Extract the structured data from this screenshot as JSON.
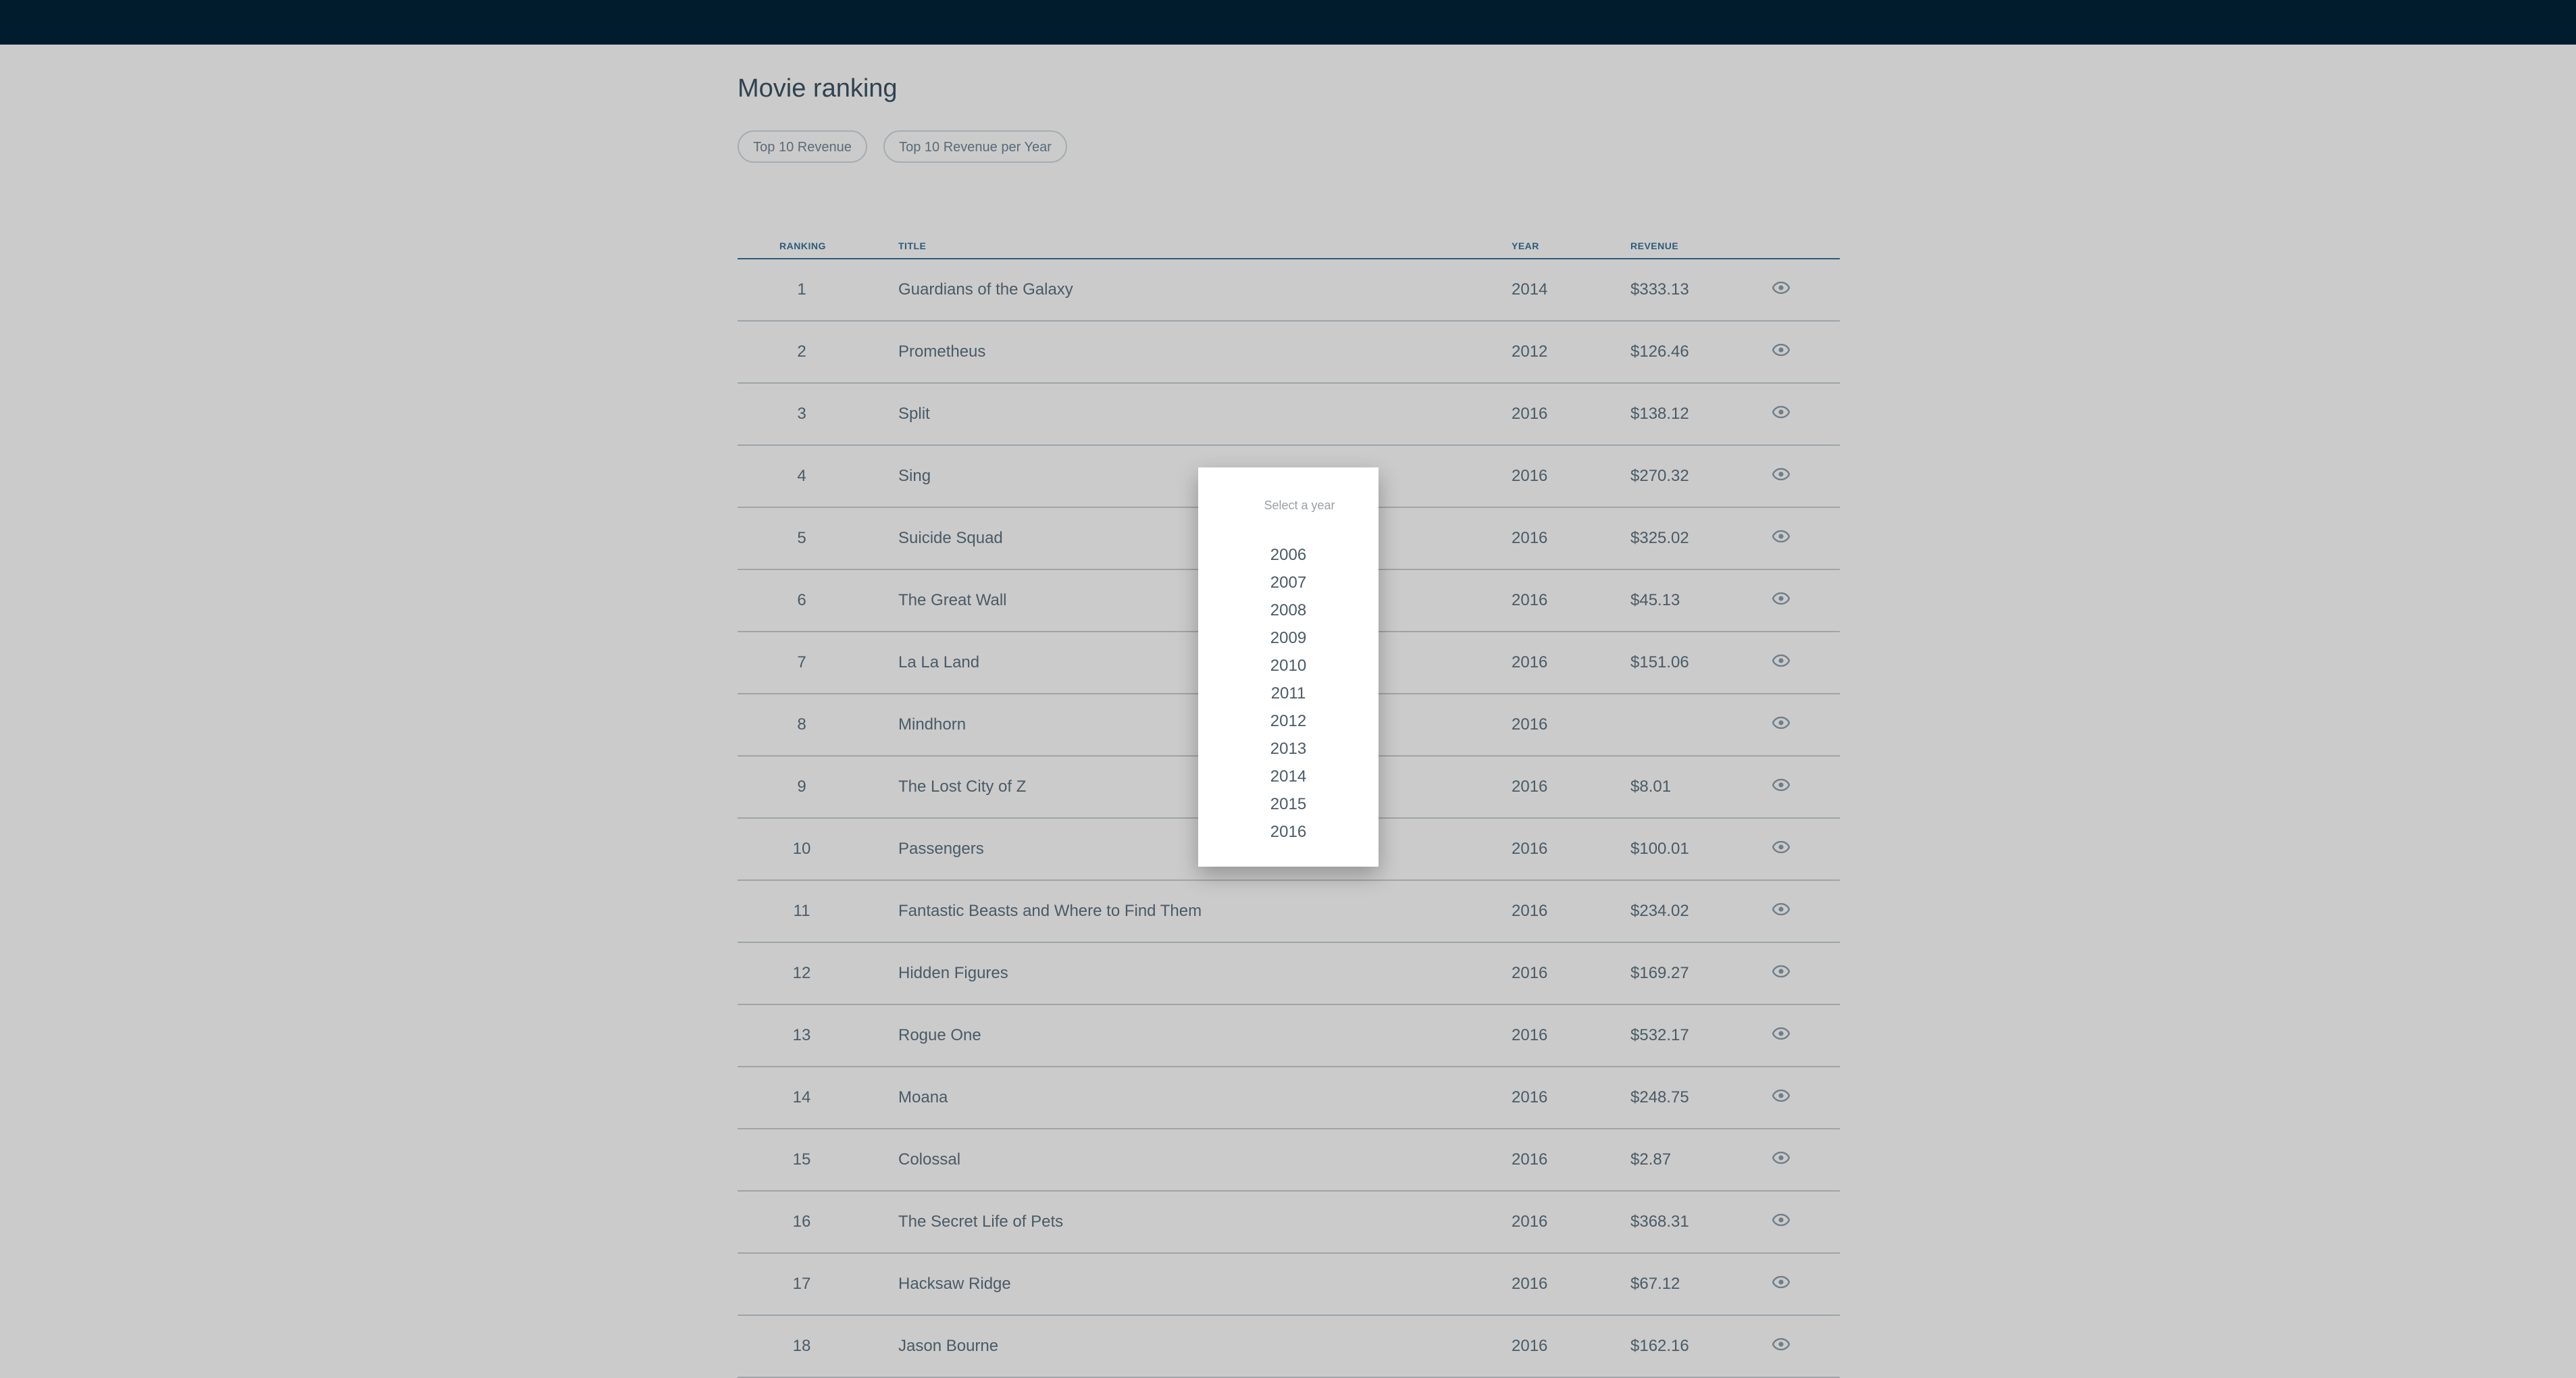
{
  "page": {
    "title": "Movie ranking"
  },
  "filters": {
    "top10": "Top 10 Revenue",
    "top10_per_year": "Top 10 Revenue per Year"
  },
  "table": {
    "headers": {
      "ranking": "RANKING",
      "title": "TITLE",
      "year": "YEAR",
      "revenue": "REVENUE"
    },
    "rows": [
      {
        "rank": "1",
        "title": "Guardians of the Galaxy",
        "year": "2014",
        "revenue": "$333.13"
      },
      {
        "rank": "2",
        "title": "Prometheus",
        "year": "2012",
        "revenue": "$126.46"
      },
      {
        "rank": "3",
        "title": "Split",
        "year": "2016",
        "revenue": "$138.12"
      },
      {
        "rank": "4",
        "title": "Sing",
        "year": "2016",
        "revenue": "$270.32"
      },
      {
        "rank": "5",
        "title": "Suicide Squad",
        "year": "2016",
        "revenue": "$325.02"
      },
      {
        "rank": "6",
        "title": "The Great Wall",
        "year": "2016",
        "revenue": "$45.13"
      },
      {
        "rank": "7",
        "title": "La La Land",
        "year": "2016",
        "revenue": "$151.06"
      },
      {
        "rank": "8",
        "title": "Mindhorn",
        "year": "2016",
        "revenue": ""
      },
      {
        "rank": "9",
        "title": "The Lost City of Z",
        "year": "2016",
        "revenue": "$8.01"
      },
      {
        "rank": "10",
        "title": "Passengers",
        "year": "2016",
        "revenue": "$100.01"
      },
      {
        "rank": "11",
        "title": "Fantastic Beasts and Where to Find Them",
        "year": "2016",
        "revenue": "$234.02"
      },
      {
        "rank": "12",
        "title": "Hidden Figures",
        "year": "2016",
        "revenue": "$169.27"
      },
      {
        "rank": "13",
        "title": "Rogue One",
        "year": "2016",
        "revenue": "$532.17"
      },
      {
        "rank": "14",
        "title": "Moana",
        "year": "2016",
        "revenue": "$248.75"
      },
      {
        "rank": "15",
        "title": "Colossal",
        "year": "2016",
        "revenue": "$2.87"
      },
      {
        "rank": "16",
        "title": "The Secret Life of Pets",
        "year": "2016",
        "revenue": "$368.31"
      },
      {
        "rank": "17",
        "title": "Hacksaw Ridge",
        "year": "2016",
        "revenue": "$67.12"
      },
      {
        "rank": "18",
        "title": "Jason Bourne",
        "year": "2016",
        "revenue": "$162.16"
      }
    ],
    "row_action_icon": "eye-icon"
  },
  "year_picker": {
    "label": "Select a year",
    "years": [
      "2006",
      "2007",
      "2008",
      "2009",
      "2010",
      "2011",
      "2012",
      "2013",
      "2014",
      "2015",
      "2016"
    ]
  },
  "colors": {
    "topbar": "#011d2d",
    "background": "#cbcbcb",
    "header_accent": "#2c5b7a",
    "text": "#4a5a66",
    "popup_bg": "#ffffff"
  }
}
